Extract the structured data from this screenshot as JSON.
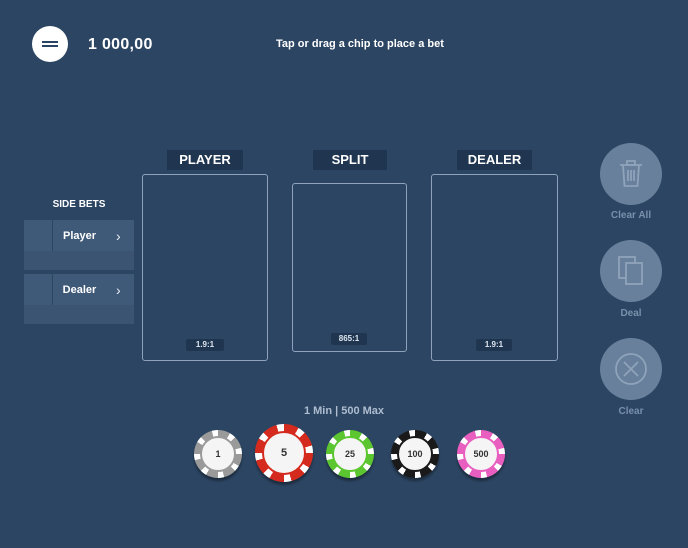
{
  "header": {
    "balance": "1 000,00",
    "hint": "Tap or drag a chip to place a bet"
  },
  "bet_areas": [
    {
      "label": "PLAYER",
      "odds": "1.9:1"
    },
    {
      "label": "SPLIT",
      "odds": "865:1"
    },
    {
      "label": "DEALER",
      "odds": "1.9:1"
    }
  ],
  "side_bets": {
    "title": "SIDE BETS",
    "items": [
      {
        "label": "Player"
      },
      {
        "label": "Dealer"
      }
    ]
  },
  "actions": [
    {
      "label": "Clear All",
      "icon": "trash-icon"
    },
    {
      "label": "Deal",
      "icon": "cards-icon"
    },
    {
      "label": "Clear",
      "icon": "close-circle-icon"
    }
  ],
  "limits": "1 Min | 500 Max",
  "chips": [
    {
      "value": "1",
      "color": "#9a9a9a"
    },
    {
      "value": "5",
      "color": "#d42b1e"
    },
    {
      "value": "25",
      "color": "#5cc630"
    },
    {
      "value": "100",
      "color": "#1a1a1a"
    },
    {
      "value": "500",
      "color": "#e85fc0"
    }
  ],
  "colors": {
    "background": "#2c4562",
    "label_bg": "#1f3550",
    "area_border": "#8ea3bb",
    "action_bg": "#68809b"
  }
}
